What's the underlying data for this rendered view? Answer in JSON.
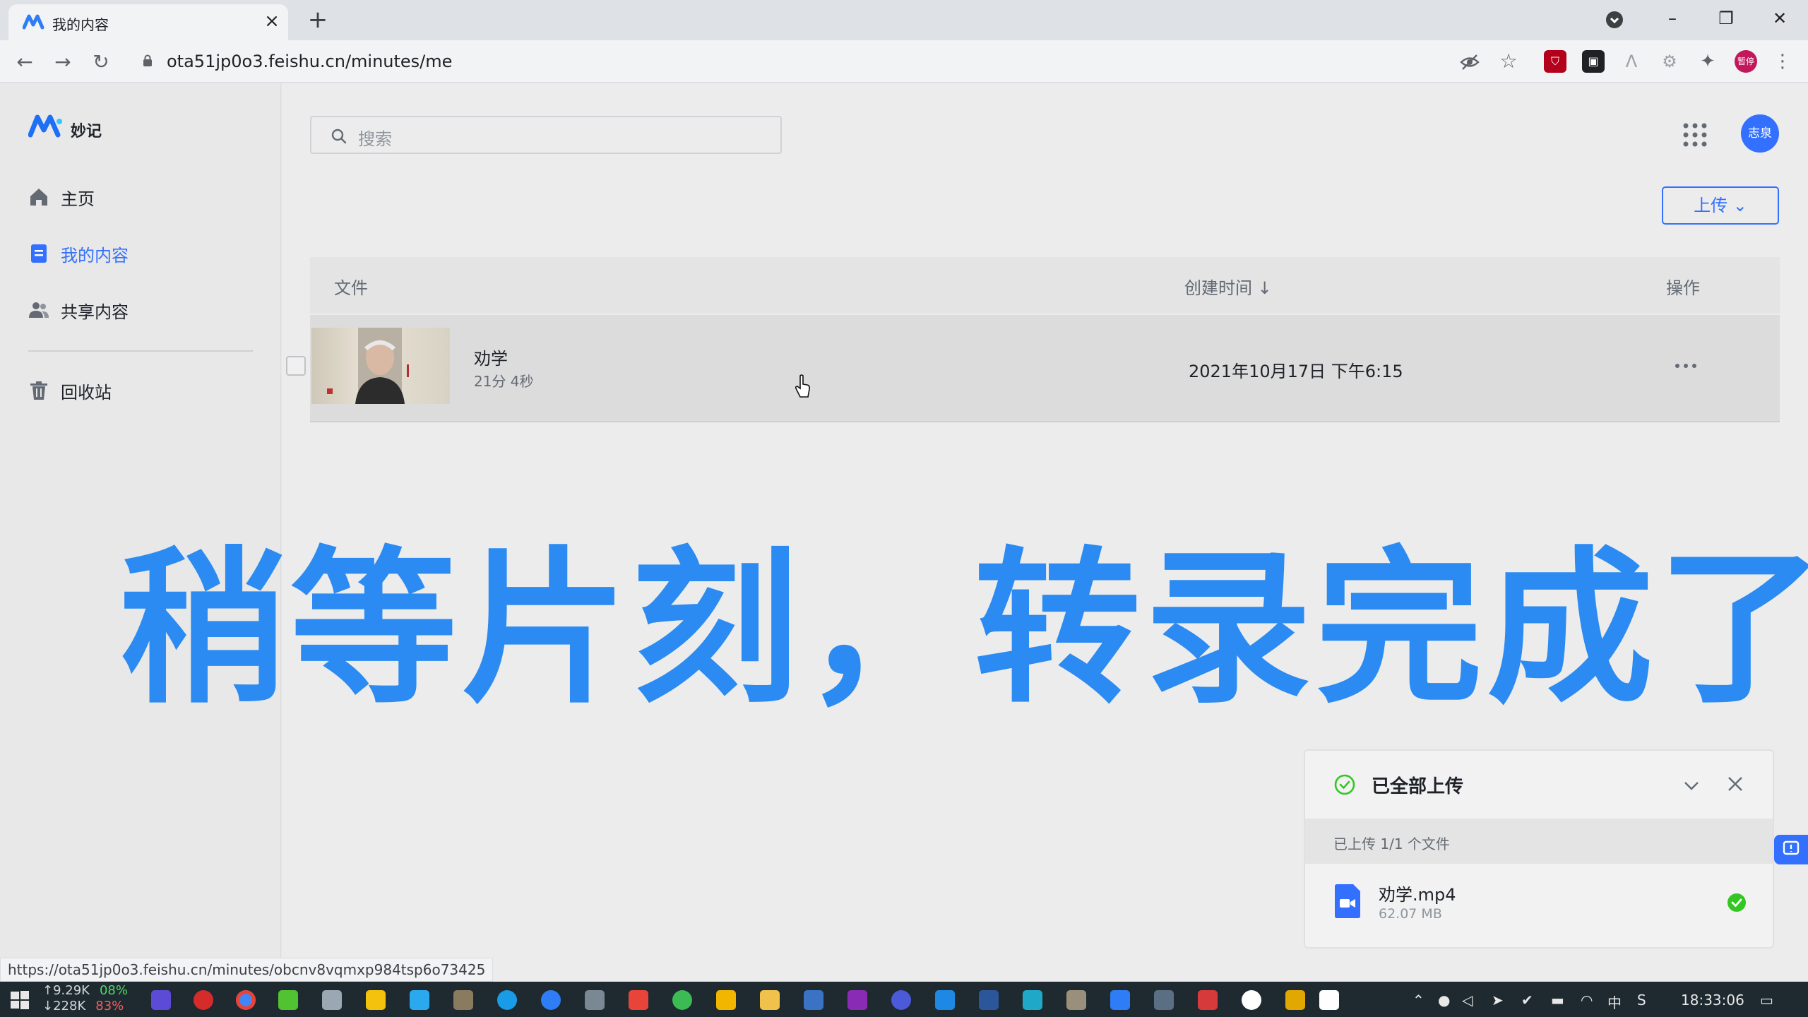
{
  "browser": {
    "tab_title": "我的内容",
    "url": "ota51jp0o3.feishu.cn/minutes/me",
    "status_url": "https://ota51jp0o3.feishu.cn/minutes/obcnv8vqmxp984tsp6o73425",
    "profile_badge": "暂停"
  },
  "app": {
    "name": "妙记"
  },
  "sidebar": {
    "items": [
      {
        "label": "主页",
        "icon": "home-icon"
      },
      {
        "label": "我的内容",
        "icon": "document-icon"
      },
      {
        "label": "共享内容",
        "icon": "users-icon"
      },
      {
        "label": "回收站",
        "icon": "trash-icon"
      }
    ]
  },
  "header": {
    "search_placeholder": "搜索",
    "avatar_text": "志泉",
    "upload_label": "上传 ⌄"
  },
  "table": {
    "columns": [
      "文件",
      "创建时间 ↓",
      "操作"
    ],
    "rows": [
      {
        "name": "劝学",
        "duration": "21分 4秒",
        "created": "2021年10月17日 下午6:15"
      }
    ]
  },
  "overlay": {
    "caption": "稍等片刻，转录完成了"
  },
  "upload_panel": {
    "title": "已全部上传",
    "subtitle": "已上传 1/1 个文件",
    "file_name": "劝学.mp4",
    "file_size": "62.07 MB"
  },
  "taskbar": {
    "net_up": "↑9.29K",
    "net_down": "↓228K",
    "pct_a": "08%",
    "pct_b": "83%",
    "ime": "中",
    "clock": "18:33:06"
  },
  "colors": {
    "accent": "#3370ff",
    "caption": "#2b8bf2",
    "success": "#34c724"
  }
}
